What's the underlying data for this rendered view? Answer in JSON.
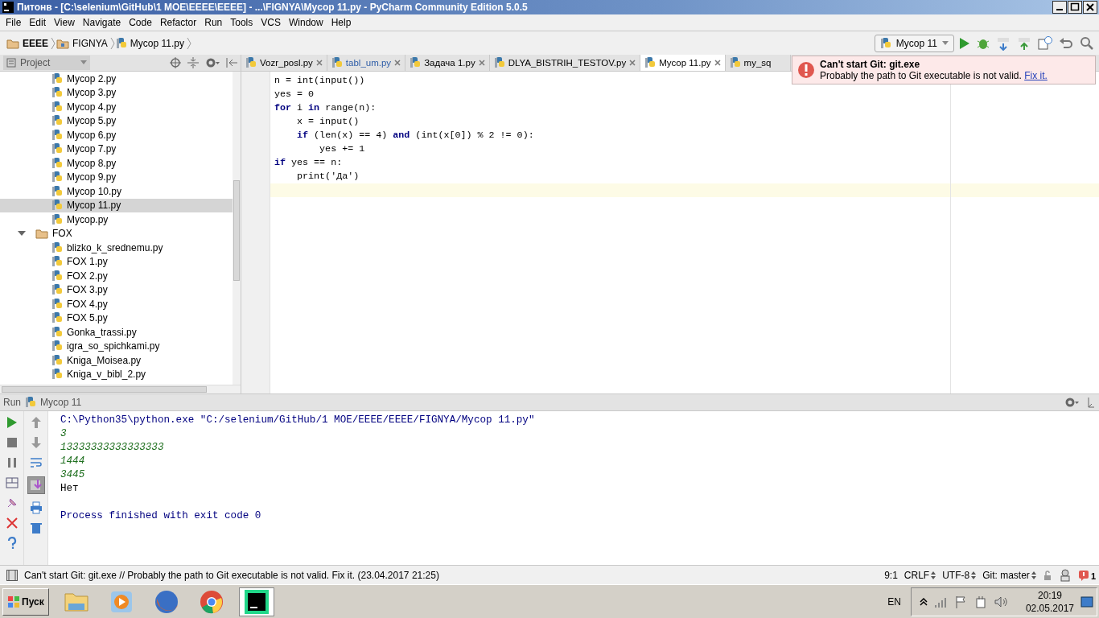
{
  "window": {
    "title": "Питонв - [C:\\selenium\\GitHub\\1 MOE\\EEEE\\EEEE] - ...\\FIGNYA\\Mycop 11.py - PyCharm Community Edition 5.0.5"
  },
  "menu": [
    "File",
    "Edit",
    "View",
    "Navigate",
    "Code",
    "Refactor",
    "Run",
    "Tools",
    "VCS",
    "Window",
    "Help"
  ],
  "breadcrumbs": [
    {
      "label": "EEEE",
      "kind": "folder"
    },
    {
      "label": "FIGNYA",
      "kind": "module"
    },
    {
      "label": "Mycop 11.py",
      "kind": "file"
    }
  ],
  "run_config": {
    "label": "Mycop 11"
  },
  "project_panel": {
    "title": "Project",
    "tree": [
      {
        "label": "Mycop 2.py",
        "kind": "file",
        "selected": false
      },
      {
        "label": "Mycop 3.py",
        "kind": "file",
        "selected": false
      },
      {
        "label": "Mycop 4.py",
        "kind": "file",
        "selected": false
      },
      {
        "label": "Mycop 5.py",
        "kind": "file",
        "selected": false
      },
      {
        "label": "Mycop 6.py",
        "kind": "file",
        "selected": false
      },
      {
        "label": "Mycop 7.py",
        "kind": "file",
        "selected": false
      },
      {
        "label": "Mycop 8.py",
        "kind": "file",
        "selected": false
      },
      {
        "label": "Mycop 9.py",
        "kind": "file",
        "selected": false
      },
      {
        "label": "Mycop 10.py",
        "kind": "file",
        "selected": false
      },
      {
        "label": "Mycop 11.py",
        "kind": "file",
        "selected": true
      },
      {
        "label": "Mycop.py",
        "kind": "file",
        "selected": false
      },
      {
        "label": "FOX",
        "kind": "folder",
        "expanded": true,
        "selected": false,
        "children": [
          {
            "label": "blizko_k_srednemu.py",
            "kind": "file",
            "selected": false
          },
          {
            "label": "FOX 1.py",
            "kind": "file",
            "selected": false
          },
          {
            "label": "FOX 2.py",
            "kind": "file",
            "selected": false
          },
          {
            "label": "FOX 3.py",
            "kind": "file",
            "selected": false
          },
          {
            "label": "FOX 4.py",
            "kind": "file",
            "selected": false
          },
          {
            "label": "FOX 5.py",
            "kind": "file",
            "selected": false
          },
          {
            "label": "Gonka_trassi.py",
            "kind": "file",
            "selected": false
          },
          {
            "label": "igra_so_spichkami.py",
            "kind": "file",
            "selected": false
          },
          {
            "label": "Kniga_Moisea.py",
            "kind": "file",
            "selected": false
          },
          {
            "label": "Kniga_v_bibl_2.py",
            "kind": "file",
            "selected": false
          }
        ]
      }
    ]
  },
  "tabs": [
    {
      "label": "Vozr_posl.py",
      "selected": false,
      "modified": false
    },
    {
      "label": "tabl_um.py",
      "selected": false,
      "modified": true
    },
    {
      "label": "Задача 1.py",
      "selected": false,
      "modified": false
    },
    {
      "label": "DLYA_BISTRIH_TESTOV.py",
      "selected": false,
      "modified": false
    },
    {
      "label": "Mycop 11.py",
      "selected": true,
      "modified": false
    },
    {
      "label": "my_sq",
      "selected": false,
      "modified": false
    }
  ],
  "editor": {
    "lines": [
      {
        "code": "n = int(input())",
        "current": false
      },
      {
        "code": "yes = 0",
        "current": false
      },
      {
        "code": "**for** i **in** range(n):",
        "current": false
      },
      {
        "code": "    x = input()",
        "current": false
      },
      {
        "code": "    **if** (len(x) == 4) **and** (int(x[0]) % 2 != 0):",
        "current": false
      },
      {
        "code": "        yes += 1",
        "current": false
      },
      {
        "code": "**if** yes == n:",
        "current": false
      },
      {
        "code": "    print('Да')",
        "current": false
      },
      {
        "current": true
      }
    ]
  },
  "notification": {
    "title": "Can't start Git: git.exe",
    "message": "Probably the path to Git executable is not valid.",
    "link": "Fix it."
  },
  "run_panel": {
    "title": "Run",
    "config": "Mycop 11",
    "console": [
      {
        "kind": "command",
        "text": "C:\\Python35\\python.exe \"C:/selenium/GitHub/1 MOE/EEEE/EEEE/FIGNYA/Mycop 11.py\""
      },
      {
        "kind": "input",
        "text": "3"
      },
      {
        "kind": "input",
        "text": "13333333333333333"
      },
      {
        "kind": "input",
        "text": "1444"
      },
      {
        "kind": "input",
        "text": "3445"
      },
      {
        "kind": "output",
        "text": "Нет"
      },
      {
        "kind": "blank"
      },
      {
        "kind": "command",
        "text": "Process finished with exit code 0"
      }
    ]
  },
  "status_bar": {
    "message": "Can't start Git: git.exe // Probably the path to Git executable is not valid. Fix it. (23.04.2017 21:25)",
    "position": "9:1",
    "line_separator": "CRLF",
    "encoding": "UTF-8",
    "vcs": "Git: master",
    "event_count": "1"
  },
  "taskbar": {
    "start": "Пуск",
    "apps": [
      {
        "kind": "explorer",
        "selected": false
      },
      {
        "kind": "media",
        "selected": false
      },
      {
        "kind": "firefox",
        "selected": false
      },
      {
        "kind": "chrome",
        "selected": false
      },
      {
        "kind": "pycharm",
        "selected": true
      }
    ],
    "language": "EN",
    "time": "20:19",
    "date": "02.05.2017"
  }
}
